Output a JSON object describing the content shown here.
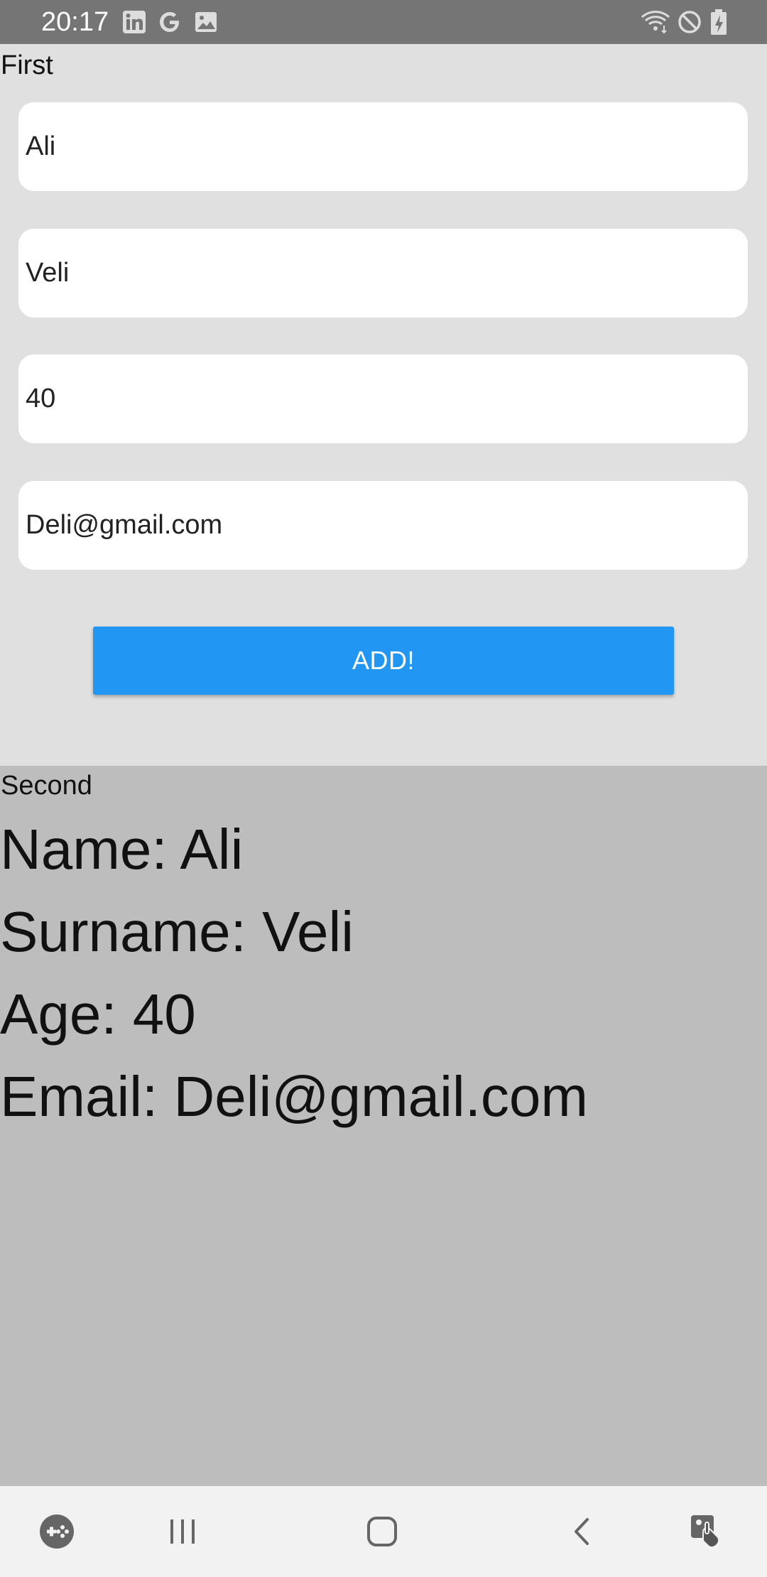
{
  "status_bar": {
    "time": "20:17",
    "left_icons": [
      "linkedin-icon",
      "google-icon",
      "image-icon"
    ],
    "right_icons": [
      "wifi-icon",
      "do-not-disturb-icon",
      "battery-charging-icon"
    ]
  },
  "first": {
    "label": "First",
    "fields": {
      "name": "Ali",
      "surname": "Veli",
      "age": "40",
      "email": "Deli@gmail.com"
    },
    "add_button_label": "ADD!",
    "accent_color": "#2196f3"
  },
  "second": {
    "label": "Second",
    "name_line": "Name: Ali",
    "surname_line": "Surname: Veli",
    "age_line": "Age: 40",
    "email_line": "Email: Deli@gmail.com"
  },
  "nav_bar": {
    "buttons": [
      "game-launcher-icon",
      "recent-apps-icon",
      "home-icon",
      "back-icon",
      "accessibility-icon"
    ]
  }
}
